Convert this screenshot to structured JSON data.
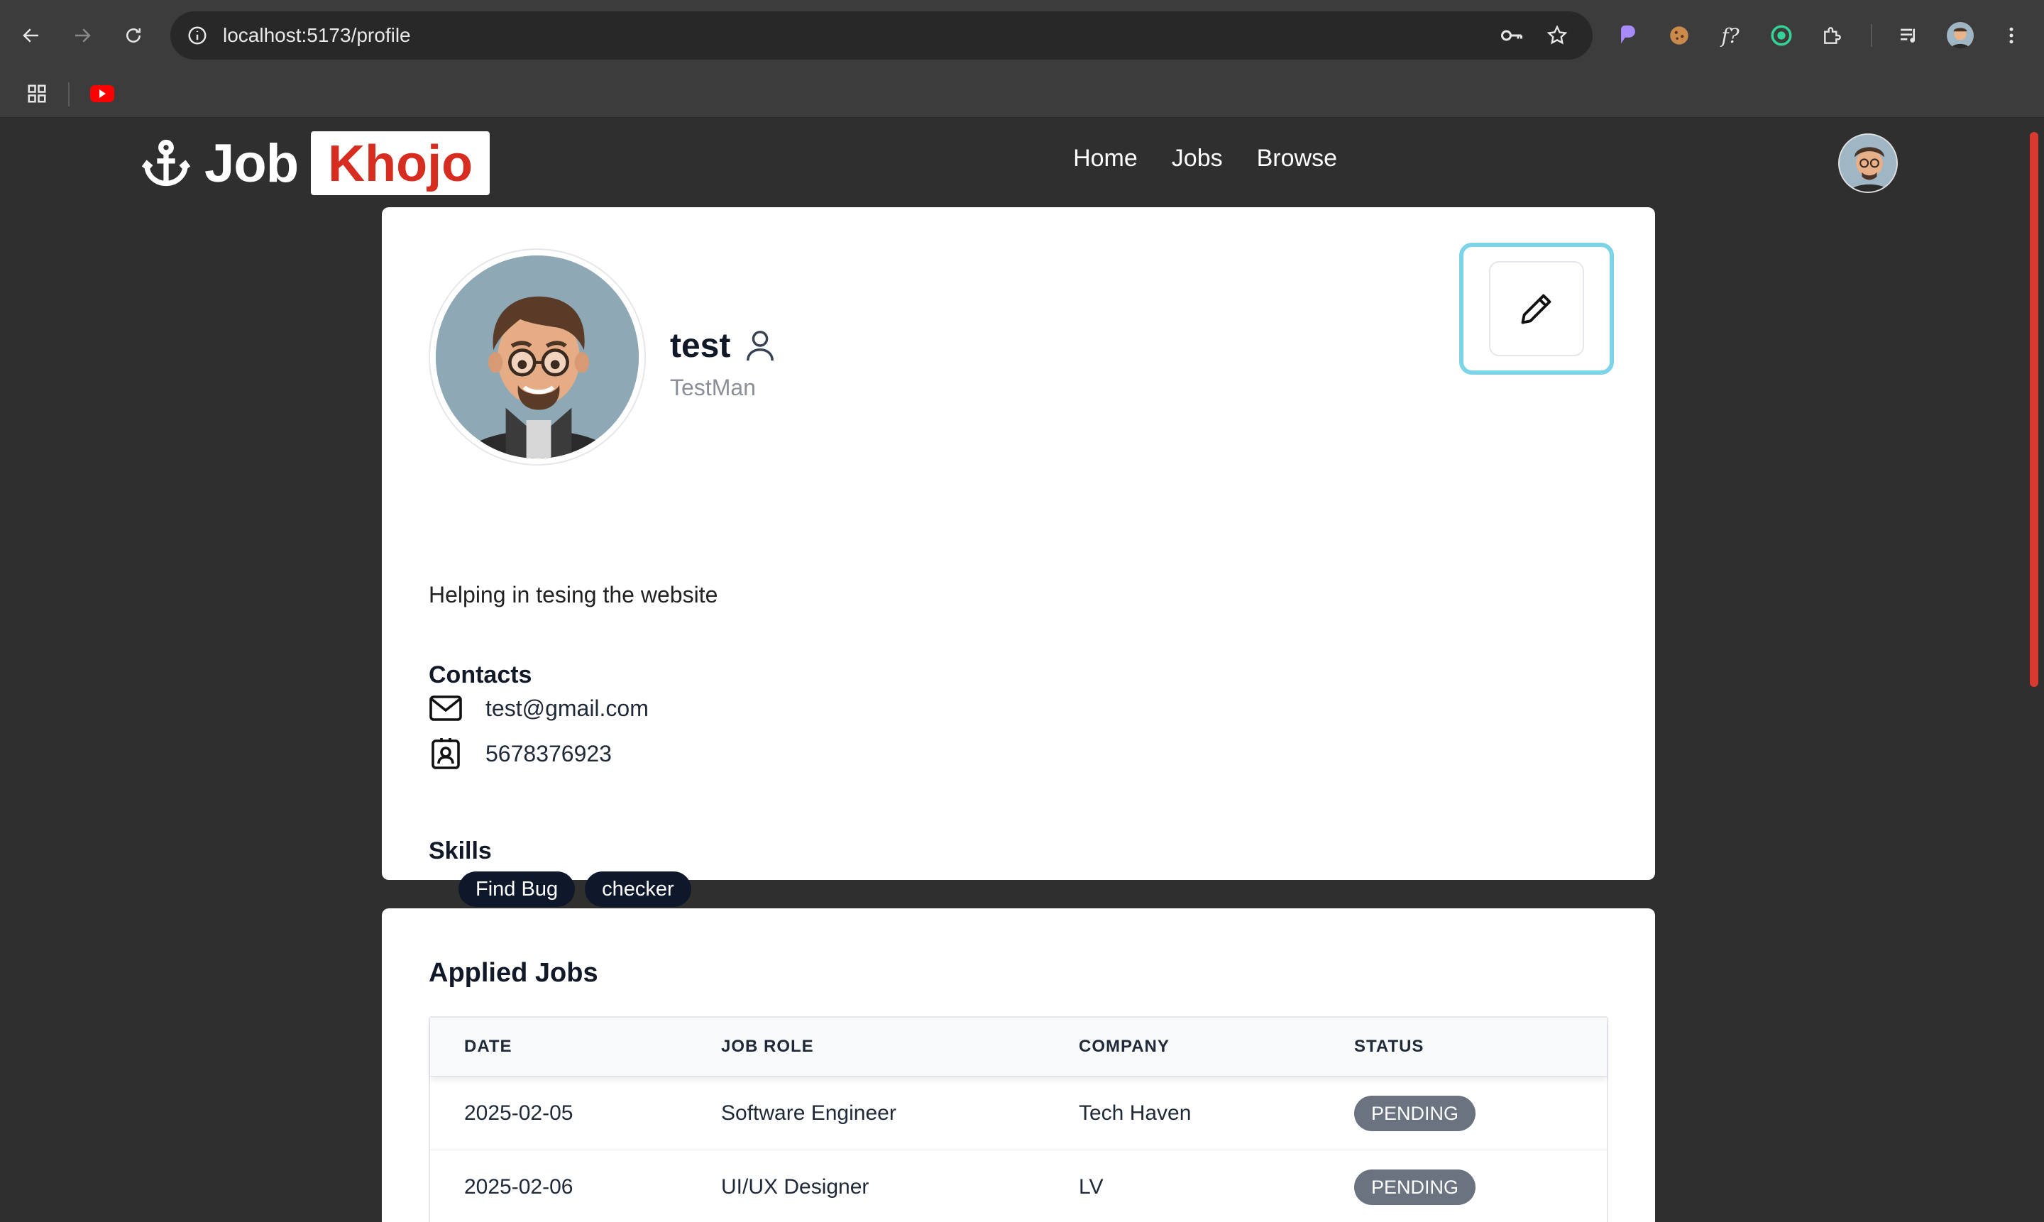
{
  "browser": {
    "url": "localhost:5173/profile"
  },
  "header": {
    "logo_part1": "Job",
    "logo_part2": "Khojo",
    "nav": [
      "Home",
      "Jobs",
      "Browse"
    ]
  },
  "profile": {
    "name": "test",
    "handle": "TestMan",
    "bio": "Helping in tesing the website",
    "contacts_title": "Contacts",
    "email": "test@gmail.com",
    "phone": "5678376923",
    "skills_title": "Skills",
    "skills": [
      "Find Bug",
      "checker"
    ]
  },
  "applied_jobs": {
    "title": "Applied Jobs",
    "columns": [
      "DATE",
      "JOB ROLE",
      "COMPANY",
      "STATUS"
    ],
    "rows": [
      {
        "date": "2025-02-05",
        "role": "Software Engineer",
        "company": "Tech Haven",
        "status": "PENDING"
      },
      {
        "date": "2025-02-06",
        "role": "UI/UX Designer",
        "company": "LV",
        "status": "PENDING"
      }
    ]
  },
  "colors": {
    "brand_red": "#d62d20",
    "skill_badge": "#0f172a",
    "status_badge": "#6b7280",
    "edit_focus_ring": "#7dd3e8"
  }
}
